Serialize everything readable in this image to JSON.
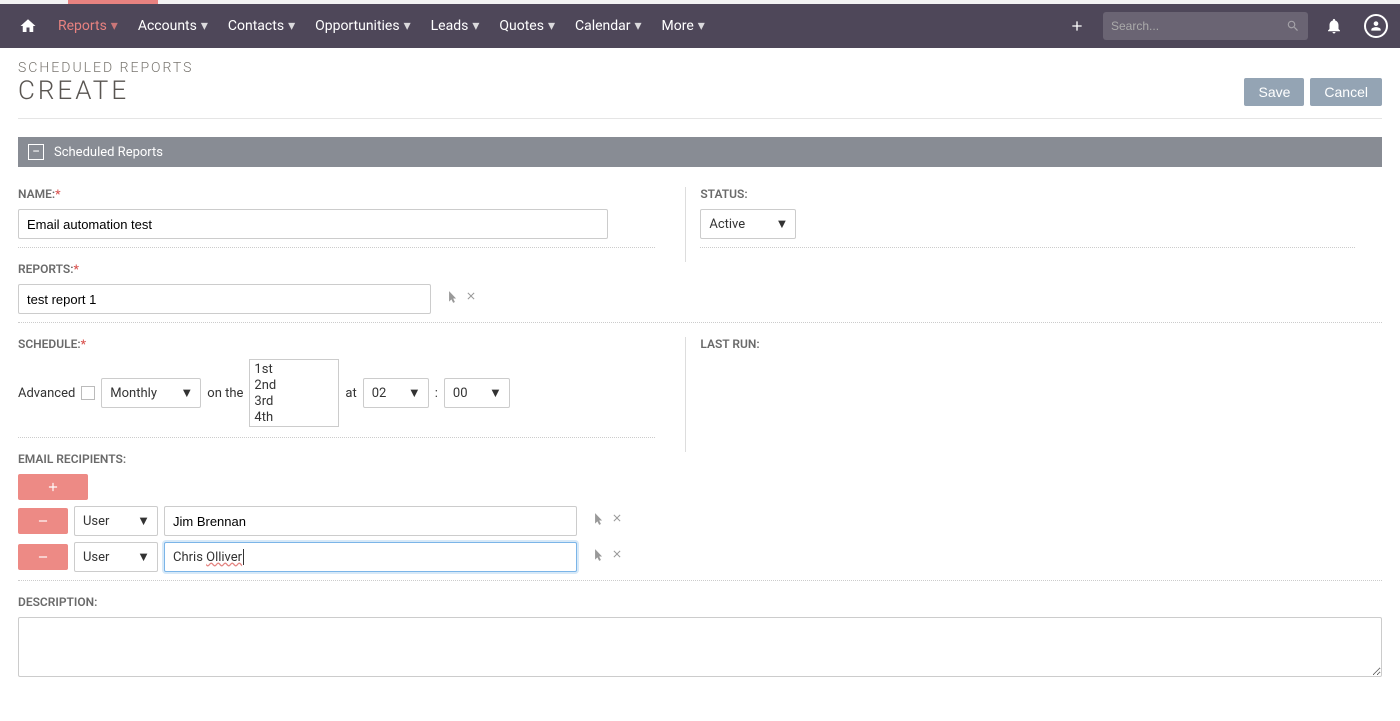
{
  "nav": {
    "items": [
      "Reports",
      "Accounts",
      "Contacts",
      "Opportunities",
      "Leads",
      "Quotes",
      "Calendar",
      "More"
    ],
    "search_placeholder": "Search..."
  },
  "header": {
    "breadcrumb": "SCHEDULED REPORTS",
    "title": "CREATE",
    "save": "Save",
    "cancel": "Cancel"
  },
  "panel": {
    "title": "Scheduled Reports"
  },
  "fields": {
    "name_label": "NAME:",
    "name_value": "Email automation test",
    "status_label": "STATUS:",
    "status_value": "Active",
    "reports_label": "REPORTS:",
    "reports_value": "test report 1",
    "schedule_label": "SCHEDULE:",
    "lastrun_label": "LAST RUN:",
    "advanced_label": "Advanced",
    "frequency": "Monthly",
    "on_the": "on the",
    "days": [
      "1st",
      "2nd",
      "3rd",
      "4th"
    ],
    "at_label": "at",
    "hour": "02",
    "colon": ":",
    "minute": "00",
    "email_label": "EMAIL RECIPIENTS:",
    "recipients": [
      {
        "type": "User",
        "name": "Jim Brennan"
      },
      {
        "type": "User",
        "name": "Chris Olliver"
      }
    ],
    "description_label": "DESCRIPTION:"
  }
}
